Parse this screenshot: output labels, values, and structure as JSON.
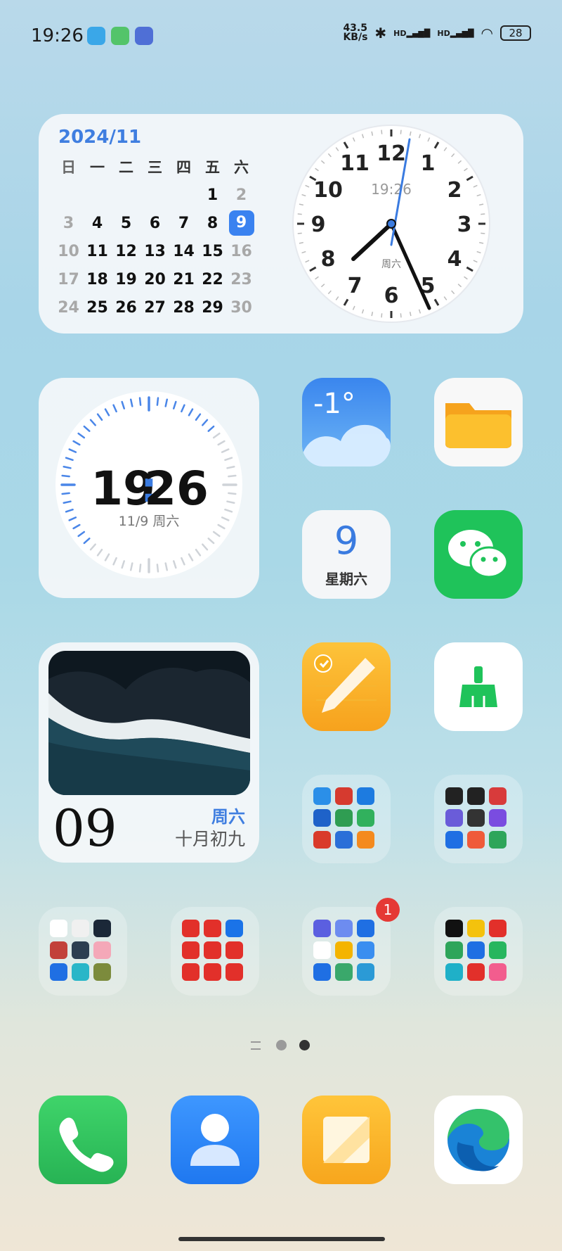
{
  "status_bar": {
    "time": "19:26",
    "net_speed_value": "43.5",
    "net_speed_unit": "KB/s",
    "signal_1": "HD",
    "signal_2": "HD",
    "battery": "28"
  },
  "calendar_widget": {
    "month": "2024/11",
    "weekdays": [
      "日",
      "一",
      "二",
      "三",
      "四",
      "五",
      "六"
    ],
    "weeks": [
      [
        "",
        "",
        "",
        "",
        "",
        "1",
        "2"
      ],
      [
        "3",
        "4",
        "5",
        "6",
        "7",
        "8",
        "9"
      ],
      [
        "10",
        "11",
        "12",
        "13",
        "14",
        "15",
        "16"
      ],
      [
        "17",
        "18",
        "19",
        "20",
        "21",
        "22",
        "23"
      ],
      [
        "24",
        "25",
        "26",
        "27",
        "28",
        "29",
        "30"
      ]
    ],
    "today": "9",
    "clock_time": "19:26",
    "clock_weekday": "周六",
    "clock_numbers": [
      "12",
      "1",
      "2",
      "3",
      "4",
      "5",
      "6",
      "7",
      "8",
      "9",
      "10",
      "11"
    ]
  },
  "digital_clock_widget": {
    "time_hours": "19",
    "time_sep": ":",
    "time_minutes": "26",
    "date": "11/9 周六"
  },
  "photo_widget": {
    "day": "09",
    "weekday": "周六",
    "lunar_date": "十月初九"
  },
  "apps": {
    "weather": {
      "temp": "-1°"
    },
    "calendar_app": {
      "day": "9",
      "weekday": "星期六"
    }
  },
  "folders": {
    "tools": [
      "#2b8fe8",
      "#d63a2f",
      "#1d7be0",
      "#1e62c9",
      "#2f9d52",
      "#31b15d",
      "#d93a2a",
      "#2a6fd8",
      "#f48a1e"
    ],
    "media": [
      "#222",
      "#222",
      "#d83b3b",
      "#6a5cd9",
      "#333",
      "#7a4ce0",
      "#1f6fe3",
      "#ef5a3a",
      "#2ea55a"
    ],
    "games": [
      "#ffffff",
      "#f0f0f0",
      "#1b2838",
      "#c2413a",
      "#2c3e50",
      "#f4a8b8",
      "#1f6fe3",
      "#29b6c8",
      "#7c8b3c"
    ],
    "shopping": [
      "#e2302a",
      "#e2302a",
      "#1a73e8",
      "#e2302a",
      "#e2302a",
      "#e2302a",
      "#e2302a",
      "#e2302a",
      "#e2302a"
    ],
    "office": [
      "#5b5fe0",
      "#6d8cf0",
      "#1f6fe3",
      "#ffffff",
      "#f4b400",
      "#3a8ef0",
      "#1f6fe3",
      "#3aa86b",
      "#2b9ad6"
    ],
    "social": [
      "#111",
      "#f4c20d",
      "#e2302a",
      "#2ea55a",
      "#1f6fe3",
      "#27b65e",
      "#1fb0c8",
      "#e2302a",
      "#f25d8e"
    ]
  },
  "office_folder_badge": "1"
}
